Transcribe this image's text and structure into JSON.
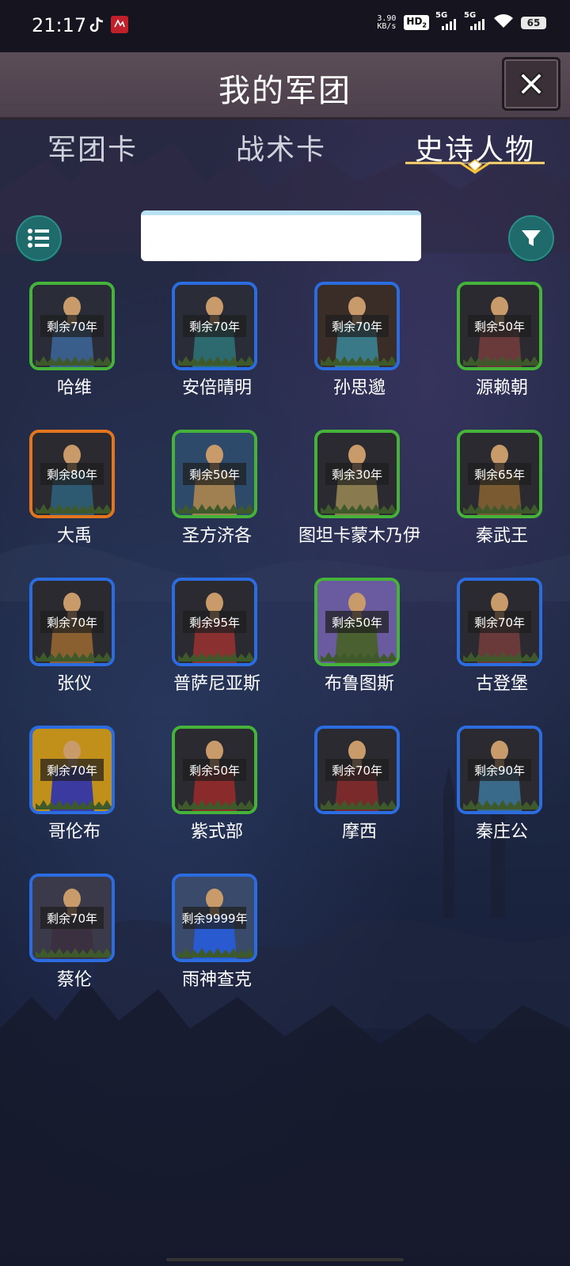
{
  "status": {
    "time": "21:17",
    "net_speed_top": "3.90",
    "net_speed_bottom": "KB/s",
    "hd": "HD",
    "hd_sub": "2",
    "sig1": "5G",
    "sig2": "5G",
    "battery": "65"
  },
  "header": {
    "title": "我的军团",
    "close_icon": "close-icon"
  },
  "tabs": [
    {
      "label": "军团卡",
      "active": false
    },
    {
      "label": "战术卡",
      "active": false
    },
    {
      "label": "史诗人物",
      "active": true
    }
  ],
  "search": {
    "value": "",
    "placeholder": ""
  },
  "cards": [
    {
      "name": "哈维",
      "remaining": "剩余70年",
      "border": "green"
    },
    {
      "name": "安倍晴明",
      "remaining": "剩余70年",
      "border": "blue"
    },
    {
      "name": "孙思邈",
      "remaining": "剩余70年",
      "border": "blue"
    },
    {
      "name": "源赖朝",
      "remaining": "剩余50年",
      "border": "green"
    },
    {
      "name": "大禹",
      "remaining": "剩余80年",
      "border": "orange"
    },
    {
      "name": "圣方济各",
      "remaining": "剩余50年",
      "border": "green"
    },
    {
      "name": "图坦卡蒙木乃伊",
      "remaining": "剩余30年",
      "border": "green"
    },
    {
      "name": "秦武王",
      "remaining": "剩余65年",
      "border": "green"
    },
    {
      "name": "张仪",
      "remaining": "剩余70年",
      "border": "blue"
    },
    {
      "name": "普萨尼亚斯",
      "remaining": "剩余95年",
      "border": "blue"
    },
    {
      "name": "布鲁图斯",
      "remaining": "剩余50年",
      "border": "green"
    },
    {
      "name": "古登堡",
      "remaining": "剩余70年",
      "border": "blue"
    },
    {
      "name": "哥伦布",
      "remaining": "剩余70年",
      "border": "blue"
    },
    {
      "name": "紫式部",
      "remaining": "剩余50年",
      "border": "green"
    },
    {
      "name": "摩西",
      "remaining": "剩余70年",
      "border": "blue"
    },
    {
      "name": "秦庄公",
      "remaining": "剩余90年",
      "border": "blue"
    },
    {
      "name": "蔡伦",
      "remaining": "剩余70年",
      "border": "blue"
    },
    {
      "name": "雨神查克",
      "remaining": "剩余9999年",
      "border": "blue"
    }
  ],
  "colors": {
    "blue": "#2b6de0",
    "green": "#45b33a",
    "orange": "#e2751d",
    "teal_button": "#1f6b6b"
  }
}
